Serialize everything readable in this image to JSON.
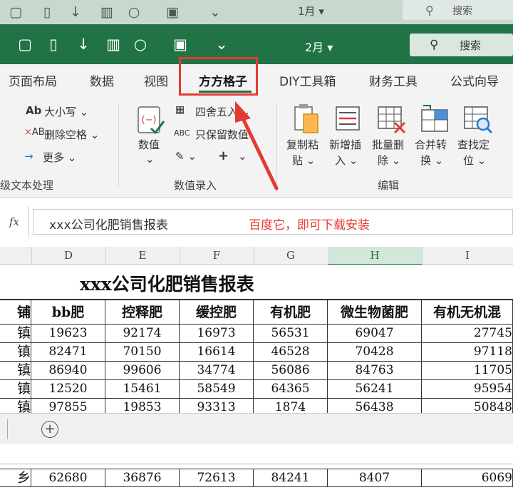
{
  "ghost_title": {
    "month": "1月",
    "search": "搜索"
  },
  "title": {
    "month": "2月",
    "search": "搜索"
  },
  "tabs": [
    {
      "label": "页面布局"
    },
    {
      "label": "数据"
    },
    {
      "label": "视图"
    },
    {
      "label": "方方格子",
      "active": true
    },
    {
      "label": "DIY工具箱"
    },
    {
      "label": "财务工具"
    },
    {
      "label": "公式向导"
    }
  ],
  "ribbon": {
    "text_group": {
      "case_label": "大小写",
      "remove_space_label": "删除空格",
      "more_label": "更多",
      "group_label": "级文本处理"
    },
    "number_group": {
      "value_label": "数值",
      "round_label": "四舍五入",
      "keep_value_label": "只保留数值",
      "group_label": "数值录入"
    },
    "edit_group": {
      "copy_paste_label": [
        "复制粘",
        "贴"
      ],
      "new_insert_label": [
        "新增插",
        "入"
      ],
      "batch_delete_label": [
        "批量删",
        "除"
      ],
      "merge_convert_label": [
        "合并转",
        "换"
      ],
      "find_locate_label": [
        "查找定",
        "位"
      ],
      "group_label": "编辑"
    }
  },
  "formula_bar": {
    "fx_label": "fx",
    "content": "xxx公司化肥销售报表",
    "annotation": "百度它，即可下载安装"
  },
  "columns": [
    "D",
    "E",
    "F",
    "G",
    "H",
    "I"
  ],
  "selected_column": "H",
  "sheet": {
    "title": "xxx公司化肥销售报表",
    "headers": [
      "铺",
      "bb肥",
      "控释肥",
      "缓控肥",
      "有机肥",
      "微生物菌肥",
      "有机无机混"
    ],
    "rows": [
      [
        "镇",
        "19623",
        "92174",
        "16973",
        "56531",
        "69047",
        "27745"
      ],
      [
        "镇",
        "82471",
        "70150",
        "16614",
        "46528",
        "70428",
        "97118"
      ],
      [
        "镇",
        "86940",
        "99606",
        "34774",
        "56086",
        "84763",
        "11705"
      ],
      [
        "镇",
        "12520",
        "15461",
        "58549",
        "64365",
        "56241",
        "95954"
      ],
      [
        "镇",
        "97855",
        "19853",
        "93313",
        "1874",
        "56438",
        "50848"
      ]
    ],
    "bottom_row": [
      "乡",
      "62680",
      "36876",
      "72613",
      "84241",
      "8407",
      "6069"
    ]
  },
  "sheet_tabs": {
    "add_label": "+"
  },
  "colors": {
    "accent": "#217346",
    "highlight": "#e53935"
  }
}
